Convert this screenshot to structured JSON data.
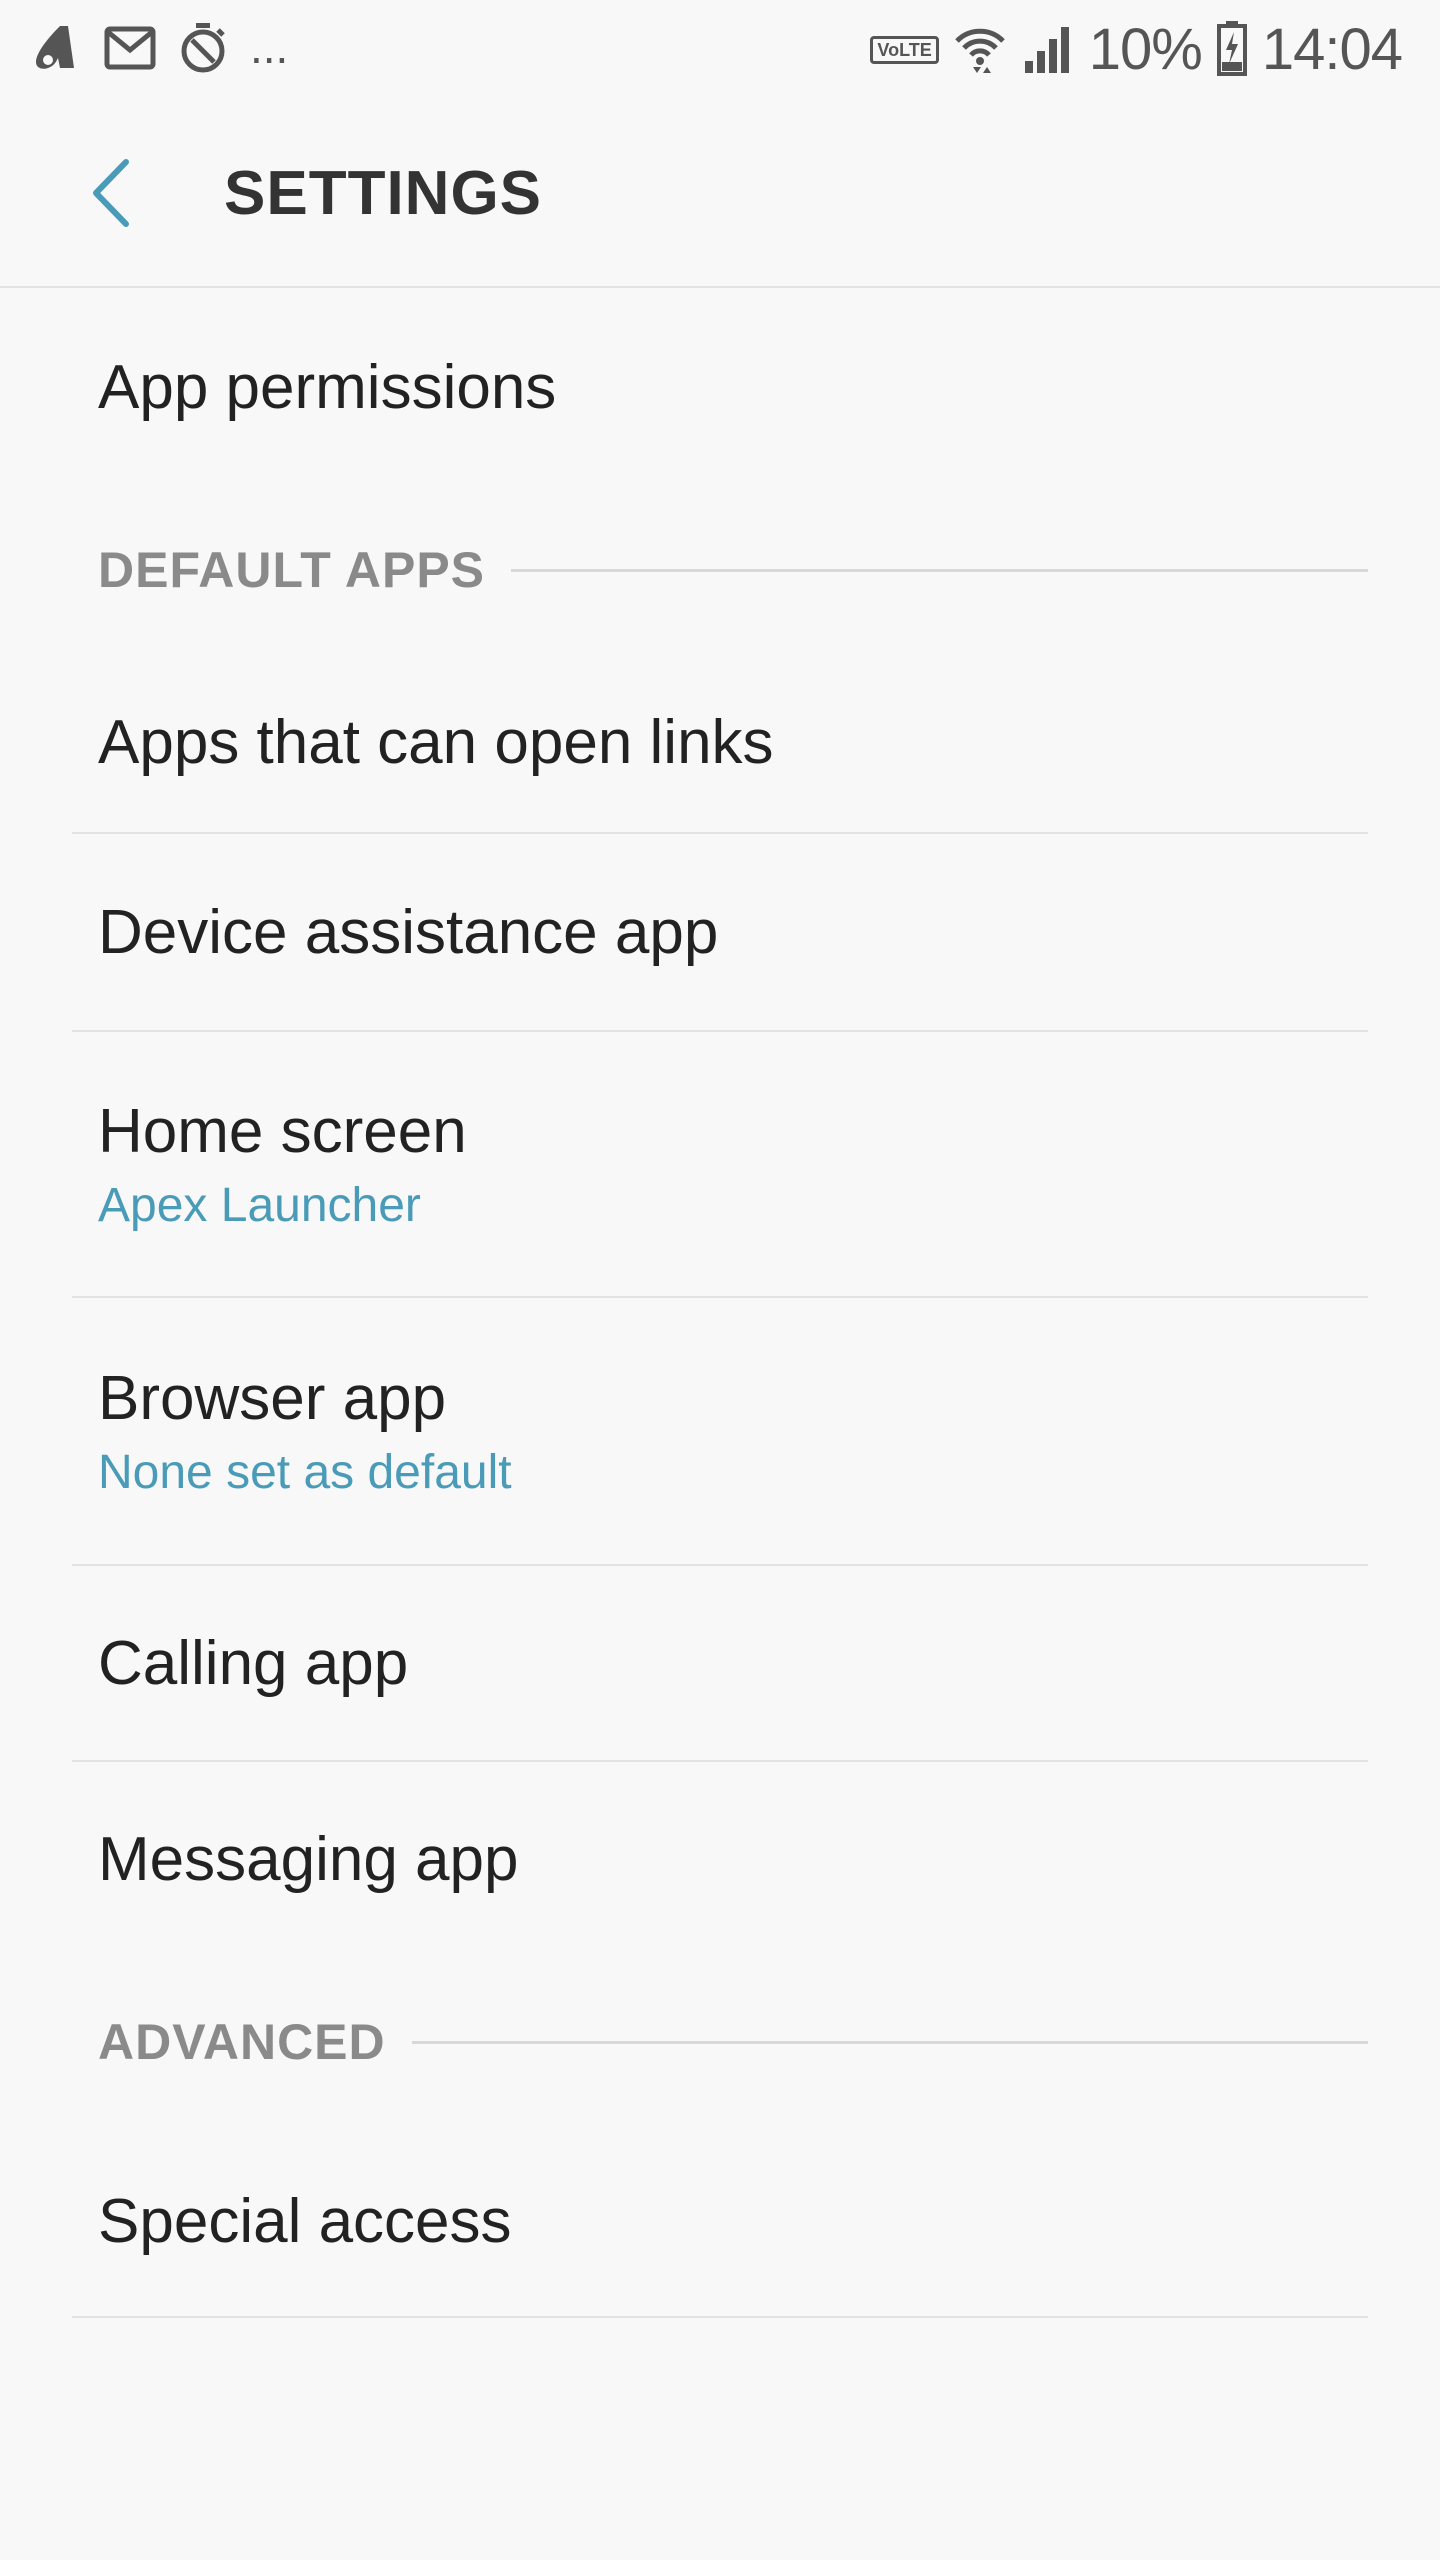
{
  "status_bar": {
    "more_indicator": "...",
    "volte": "VoLTE",
    "battery_percent": "10%",
    "time": "14:04",
    "left_icons": [
      "app-notification-icon",
      "gmail-icon",
      "timer-icon"
    ],
    "right_icons": [
      "volte-icon",
      "wifi-icon",
      "signal-icon",
      "battery-icon"
    ]
  },
  "app_bar": {
    "title": "SETTINGS",
    "back_icon": "chevron-left-icon",
    "accent_color": "#4a9bb8"
  },
  "items": {
    "app_permissions": {
      "title": "App permissions"
    },
    "section_default_apps": {
      "label": "DEFAULT APPS"
    },
    "open_links": {
      "title": "Apps that can open links"
    },
    "device_assistance": {
      "title": "Device assistance app"
    },
    "home_screen": {
      "title": "Home screen",
      "subtitle": "Apex Launcher"
    },
    "browser_app": {
      "title": "Browser app",
      "subtitle": "None set as default"
    },
    "calling_app": {
      "title": "Calling app"
    },
    "messaging_app": {
      "title": "Messaging app"
    },
    "section_advanced": {
      "label": "ADVANCED"
    },
    "special_access": {
      "title": "Special access"
    }
  }
}
